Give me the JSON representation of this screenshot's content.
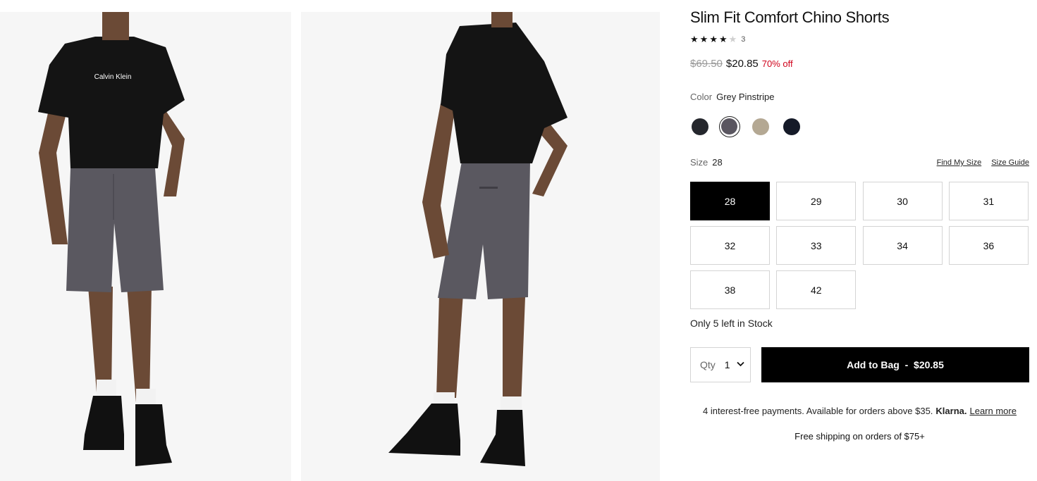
{
  "product": {
    "title": "Slim Fit Comfort Chino Shorts",
    "rating_value": 4,
    "rating_max": 5,
    "review_count": "3",
    "original_price": "$69.50",
    "sale_price": "$20.85",
    "discount": "70% off"
  },
  "color": {
    "label": "Color",
    "selected": "Grey Pinstripe",
    "swatches": [
      {
        "hex": "#25272d"
      },
      {
        "hex": "#5a5660",
        "selected": true
      },
      {
        "hex": "#b4a893"
      },
      {
        "hex": "#151a28"
      }
    ]
  },
  "size": {
    "label": "Size",
    "selected": "28",
    "find_my_size": "Find My Size",
    "size_guide": "Size Guide",
    "options": [
      "28",
      "29",
      "30",
      "31",
      "32",
      "33",
      "34",
      "36",
      "38",
      "42"
    ]
  },
  "stock_message": "Only 5 left in Stock",
  "quantity": {
    "label": "Qty",
    "value": "1"
  },
  "add_to_bag": {
    "label": "Add to Bag",
    "separator": "-",
    "price": "$20.85"
  },
  "klarna": {
    "text": "4 interest-free payments. Available for orders above $35.",
    "brand": "Klarna.",
    "link": "Learn more"
  },
  "shipping_message": "Free shipping on orders of $75+",
  "images": {
    "front_shirt_logo": "Calvin Klein"
  },
  "colors": {
    "shirt": "#141414",
    "shorts": "#5a5860",
    "skin": "#6b4a36",
    "boot": "#111111",
    "sock": "#f2f2f2",
    "panel_bg": "#f6f6f6",
    "sale": "#d0021b"
  },
  "icons": {
    "star": "star-icon",
    "chevron": "chevron-down-icon"
  }
}
